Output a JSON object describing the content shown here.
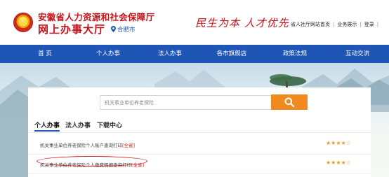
{
  "header": {
    "title_line1": "安徽省人力资源和社会保障厅",
    "title_line2": "网上办事大厅",
    "city": "合肥市",
    "slogan": "民生为本  人才优先",
    "links": [
      "省人社厅网站首页",
      "业务展示",
      "登录"
    ]
  },
  "nav": {
    "items": [
      "首  页",
      "个人办事",
      "法人办事",
      "各市旗舰店",
      "政策法规",
      "互动交流"
    ]
  },
  "search": {
    "placeholder": "机关事业单位养老保险"
  },
  "tabs": [
    "个人办事",
    "法人办事",
    "下载中心"
  ],
  "rows": [
    {
      "text": "机关事业单位养老保险个人账户查询打印",
      "tag": "[全省]",
      "rating": "★★★★☆"
    },
    {
      "text": "机关事业单位养老保险个人缴费明细查询打印",
      "tag": "[全省]",
      "rating": "★★★★☆"
    }
  ],
  "colors": {
    "brand_red": "#c4131a",
    "nav_blue": "#1f55b5",
    "search_orange": "#f08a1f",
    "star_orange": "#e69b1f"
  }
}
